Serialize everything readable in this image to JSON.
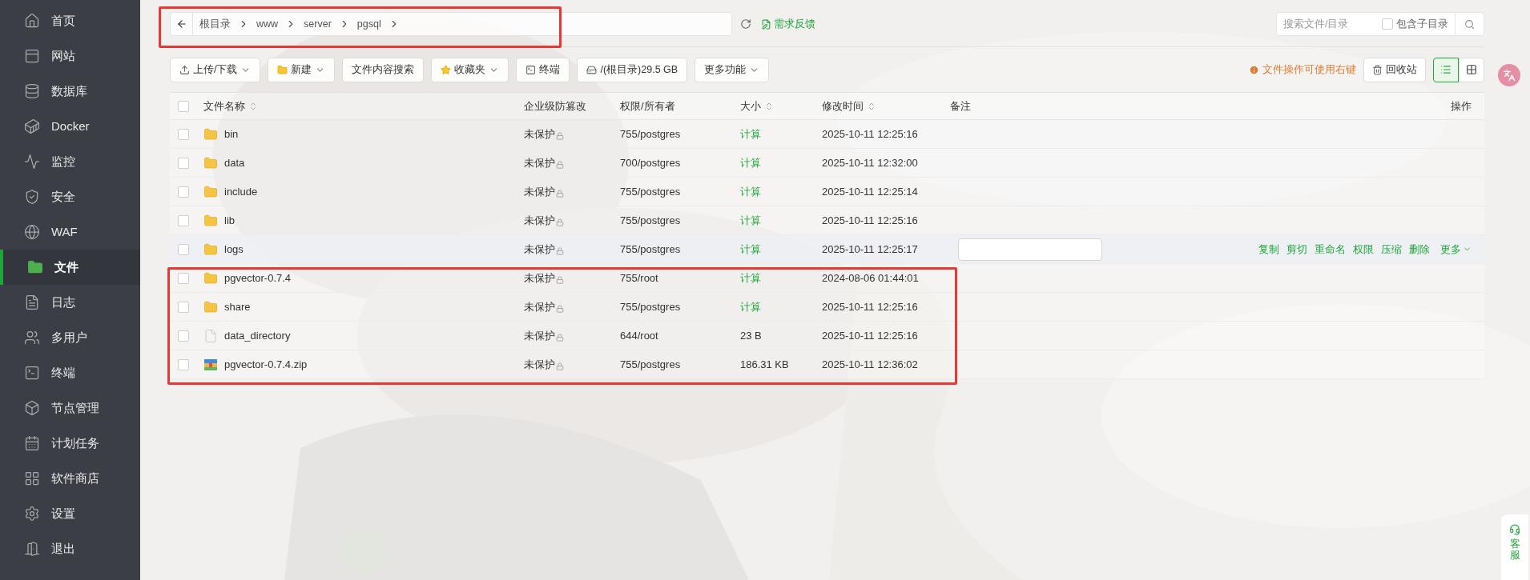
{
  "sidebar": {
    "items": [
      {
        "label": "首页",
        "selected": false
      },
      {
        "label": "网站",
        "selected": false
      },
      {
        "label": "数据库",
        "selected": false
      },
      {
        "label": "Docker",
        "selected": false
      },
      {
        "label": "监控",
        "selected": false
      },
      {
        "label": "安全",
        "selected": false
      },
      {
        "label": "WAF",
        "selected": false
      },
      {
        "label": "文件",
        "selected": true
      },
      {
        "label": "日志",
        "selected": false
      },
      {
        "label": "多用户",
        "selected": false
      },
      {
        "label": "终端",
        "selected": false
      },
      {
        "label": "节点管理",
        "selected": false
      },
      {
        "label": "计划任务",
        "selected": false
      },
      {
        "label": "软件商店",
        "selected": false
      },
      {
        "label": "设置",
        "selected": false
      },
      {
        "label": "退出",
        "selected": false
      }
    ]
  },
  "path_bar": {
    "breadcrumbs": [
      "根目录",
      "www",
      "server",
      "pgsql"
    ],
    "feedback": "需求反馈"
  },
  "search": {
    "placeholder": "搜索文件/目录",
    "subdir_label": "包含子目录",
    "subdir_checked": false
  },
  "toolbar": {
    "buttons": [
      {
        "label": "上传/下载",
        "dropdown": true
      },
      {
        "label": "新建",
        "dropdown": true
      },
      {
        "label": "文件内容搜索",
        "dropdown": false
      },
      {
        "label": "收藏夹",
        "dropdown": true
      },
      {
        "label": "终端",
        "dropdown": false
      },
      {
        "label": "/(根目录)29.5 GB",
        "dropdown": false
      },
      {
        "label": "更多功能",
        "dropdown": true
      }
    ],
    "tip": "文件操作可使用右键",
    "recycle": "回收站",
    "views": [
      {
        "kind": "list",
        "selected": true
      },
      {
        "kind": "grid",
        "selected": false
      }
    ]
  },
  "table": {
    "header_checked": false,
    "columns": [
      {
        "label": "文件名称",
        "sortable": true
      },
      {
        "label": "企业级防篡改",
        "sortable": false
      },
      {
        "label": "权限/所有者",
        "sortable": false
      },
      {
        "label": "大小",
        "sortable": true
      },
      {
        "label": "修改时间",
        "sortable": true
      },
      {
        "label": "备注",
        "sortable": false
      },
      {
        "label": "操作",
        "sortable": false
      }
    ],
    "rows": [
      {
        "name": "bin",
        "kind": "folder",
        "protection": "未保护",
        "perms": "755/postgres",
        "size": "计算",
        "size_link": true,
        "mtime": "2025-10-11 12:25:16",
        "checked": false,
        "hovered": false
      },
      {
        "name": "data",
        "kind": "folder",
        "protection": "未保护",
        "perms": "700/postgres",
        "size": "计算",
        "size_link": true,
        "mtime": "2025-10-11 12:32:00",
        "checked": false,
        "hovered": false
      },
      {
        "name": "include",
        "kind": "folder",
        "protection": "未保护",
        "perms": "755/postgres",
        "size": "计算",
        "size_link": true,
        "mtime": "2025-10-11 12:25:14",
        "checked": false,
        "hovered": false
      },
      {
        "name": "lib",
        "kind": "folder",
        "protection": "未保护",
        "perms": "755/postgres",
        "size": "计算",
        "size_link": true,
        "mtime": "2025-10-11 12:25:16",
        "checked": false,
        "hovered": false
      },
      {
        "name": "logs",
        "kind": "folder",
        "protection": "未保护",
        "perms": "755/postgres",
        "size": "计算",
        "size_link": true,
        "mtime": "2025-10-11 12:25:17",
        "checked": false,
        "hovered": true,
        "actions": [
          "复制",
          "剪切",
          "重命名",
          "权限",
          "压缩",
          "删除",
          "更多"
        ]
      },
      {
        "name": "pgvector-0.7.4",
        "kind": "folder",
        "protection": "未保护",
        "perms": "755/root",
        "size": "计算",
        "size_link": true,
        "mtime": "2024-08-06 01:44:01",
        "checked": false,
        "hovered": false
      },
      {
        "name": "share",
        "kind": "folder",
        "protection": "未保护",
        "perms": "755/postgres",
        "size": "计算",
        "size_link": true,
        "mtime": "2025-10-11 12:25:16",
        "checked": false,
        "hovered": false
      },
      {
        "name": "data_directory",
        "kind": "file",
        "protection": "未保护",
        "perms": "644/root",
        "size": "23 B",
        "size_link": false,
        "mtime": "2025-10-11 12:25:16",
        "checked": false,
        "hovered": false
      },
      {
        "name": "pgvector-0.7.4.zip",
        "kind": "archive",
        "protection": "未保护",
        "perms": "755/postgres",
        "size": "186.31 KB",
        "size_link": false,
        "mtime": "2025-10-11 12:36:02",
        "checked": false,
        "hovered": false
      }
    ]
  },
  "support": {
    "label": "客服"
  }
}
